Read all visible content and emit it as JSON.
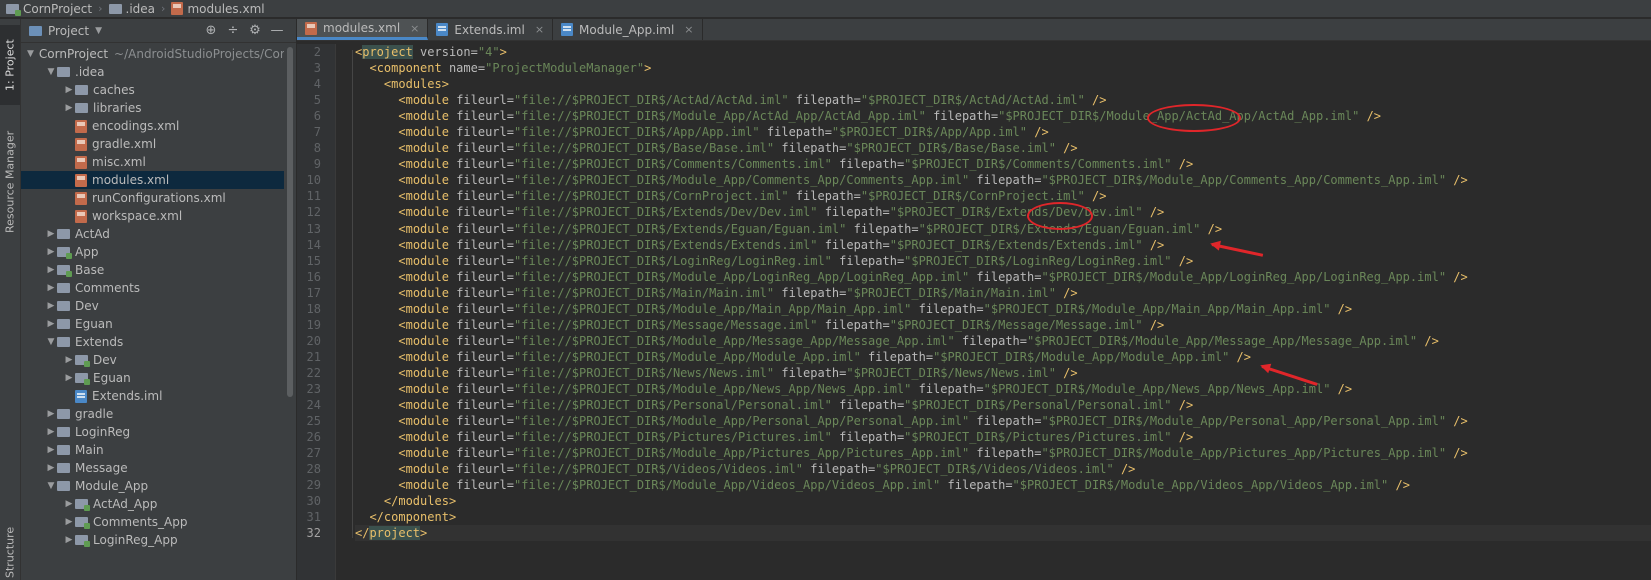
{
  "breadcrumb": [
    "CornProject",
    ".idea",
    "modules.xml"
  ],
  "left_strip": {
    "project_tab": "1: Project",
    "resource_tab": "Resource Manager",
    "structure_tab": "Structure"
  },
  "project_panel": {
    "title": "Project",
    "tree": [
      {
        "label": "CornProject",
        "hint": "~/AndroidStudioProjects/Cor",
        "indent": 0,
        "expanded": true,
        "icon": "folder-icon"
      },
      {
        "label": ".idea",
        "indent": 1,
        "expanded": true,
        "icon": "folder-icon"
      },
      {
        "label": "caches",
        "indent": 2,
        "expanded": false,
        "icon": "folder-icon"
      },
      {
        "label": "libraries",
        "indent": 2,
        "expanded": false,
        "icon": "folder-icon"
      },
      {
        "label": "encodings.xml",
        "indent": 2,
        "icon": "xml-file-icon"
      },
      {
        "label": "gradle.xml",
        "indent": 2,
        "icon": "xml-file-icon"
      },
      {
        "label": "misc.xml",
        "indent": 2,
        "icon": "xml-file-icon"
      },
      {
        "label": "modules.xml",
        "indent": 2,
        "icon": "xml-file-icon",
        "selected": true
      },
      {
        "label": "runConfigurations.xml",
        "indent": 2,
        "icon": "xml-file-icon"
      },
      {
        "label": "workspace.xml",
        "indent": 2,
        "icon": "xml-file-icon"
      },
      {
        "label": "ActAd",
        "indent": 1,
        "expanded": false,
        "icon": "folder-icon"
      },
      {
        "label": "App",
        "indent": 1,
        "expanded": false,
        "icon": "module-folder-icon"
      },
      {
        "label": "Base",
        "indent": 1,
        "expanded": false,
        "icon": "module-folder-icon"
      },
      {
        "label": "Comments",
        "indent": 1,
        "expanded": false,
        "icon": "folder-icon"
      },
      {
        "label": "Dev",
        "indent": 1,
        "expanded": false,
        "icon": "folder-icon"
      },
      {
        "label": "Eguan",
        "indent": 1,
        "expanded": false,
        "icon": "folder-icon"
      },
      {
        "label": "Extends",
        "indent": 1,
        "expanded": true,
        "icon": "folder-icon"
      },
      {
        "label": "Dev",
        "indent": 2,
        "expanded": false,
        "icon": "module-folder-icon"
      },
      {
        "label": "Eguan",
        "indent": 2,
        "expanded": false,
        "icon": "module-folder-icon"
      },
      {
        "label": "Extends.iml",
        "indent": 2,
        "icon": "iml-file-icon"
      },
      {
        "label": "gradle",
        "indent": 1,
        "expanded": false,
        "icon": "folder-icon"
      },
      {
        "label": "LoginReg",
        "indent": 1,
        "expanded": false,
        "icon": "folder-icon"
      },
      {
        "label": "Main",
        "indent": 1,
        "expanded": false,
        "icon": "folder-icon"
      },
      {
        "label": "Message",
        "indent": 1,
        "expanded": false,
        "icon": "folder-icon"
      },
      {
        "label": "Module_App",
        "indent": 1,
        "expanded": true,
        "icon": "folder-icon"
      },
      {
        "label": "ActAd_App",
        "indent": 2,
        "expanded": false,
        "icon": "module-folder-icon"
      },
      {
        "label": "Comments_App",
        "indent": 2,
        "expanded": false,
        "icon": "module-folder-icon"
      },
      {
        "label": "LoginReg_App",
        "indent": 2,
        "expanded": false,
        "icon": "module-folder-icon"
      }
    ]
  },
  "tabs": [
    {
      "label": "modules.xml",
      "icon": "xml-file-icon",
      "active": true
    },
    {
      "label": "Extends.iml",
      "icon": "iml-file-icon",
      "active": false
    },
    {
      "label": "Module_App.iml",
      "icon": "iml-file-icon",
      "active": false
    }
  ],
  "editor": {
    "current_line": 32,
    "lines": [
      {
        "n": 2,
        "indent": 0,
        "tag": "project",
        "kind": "open",
        "attrs": [
          [
            "version",
            "4"
          ]
        ]
      },
      {
        "n": 3,
        "indent": 1,
        "tag": "component",
        "kind": "open",
        "attrs": [
          [
            "name",
            "ProjectModuleManager"
          ]
        ]
      },
      {
        "n": 4,
        "indent": 2,
        "tag": "modules",
        "kind": "open",
        "attrs": []
      },
      {
        "n": 5,
        "indent": 3,
        "tag": "module",
        "kind": "self",
        "attrs": [
          [
            "fileurl",
            "file://$PROJECT_DIR$/ActAd/ActAd.iml"
          ],
          [
            "filepath",
            "$PROJECT_DIR$/ActAd/ActAd.iml"
          ]
        ]
      },
      {
        "n": 6,
        "indent": 3,
        "tag": "module",
        "kind": "self",
        "attrs": [
          [
            "fileurl",
            "file://$PROJECT_DIR$/Module_App/ActAd_App/ActAd_App.iml"
          ],
          [
            "filepath",
            "$PROJECT_DIR$/Module_App/ActAd_App/ActAd_App.iml"
          ]
        ]
      },
      {
        "n": 7,
        "indent": 3,
        "tag": "module",
        "kind": "self",
        "attrs": [
          [
            "fileurl",
            "file://$PROJECT_DIR$/App/App.iml"
          ],
          [
            "filepath",
            "$PROJECT_DIR$/App/App.iml"
          ]
        ]
      },
      {
        "n": 8,
        "indent": 3,
        "tag": "module",
        "kind": "self",
        "attrs": [
          [
            "fileurl",
            "file://$PROJECT_DIR$/Base/Base.iml"
          ],
          [
            "filepath",
            "$PROJECT_DIR$/Base/Base.iml"
          ]
        ]
      },
      {
        "n": 9,
        "indent": 3,
        "tag": "module",
        "kind": "self",
        "attrs": [
          [
            "fileurl",
            "file://$PROJECT_DIR$/Comments/Comments.iml"
          ],
          [
            "filepath",
            "$PROJECT_DIR$/Comments/Comments.iml"
          ]
        ]
      },
      {
        "n": 10,
        "indent": 3,
        "tag": "module",
        "kind": "self",
        "attrs": [
          [
            "fileurl",
            "file://$PROJECT_DIR$/Module_App/Comments_App/Comments_App.iml"
          ],
          [
            "filepath",
            "$PROJECT_DIR$/Module_App/Comments_App/Comments_App.iml"
          ]
        ]
      },
      {
        "n": 11,
        "indent": 3,
        "tag": "module",
        "kind": "self",
        "attrs": [
          [
            "fileurl",
            "file://$PROJECT_DIR$/CornProject.iml"
          ],
          [
            "filepath",
            "$PROJECT_DIR$/CornProject.iml"
          ]
        ]
      },
      {
        "n": 12,
        "indent": 3,
        "tag": "module",
        "kind": "self",
        "attrs": [
          [
            "fileurl",
            "file://$PROJECT_DIR$/Extends/Dev/Dev.iml"
          ],
          [
            "filepath",
            "$PROJECT_DIR$/Extends/Dev/Dev.iml"
          ]
        ]
      },
      {
        "n": 13,
        "indent": 3,
        "tag": "module",
        "kind": "self",
        "attrs": [
          [
            "fileurl",
            "file://$PROJECT_DIR$/Extends/Eguan/Eguan.iml"
          ],
          [
            "filepath",
            "$PROJECT_DIR$/Extends/Eguan/Eguan.iml"
          ]
        ]
      },
      {
        "n": 14,
        "indent": 3,
        "tag": "module",
        "kind": "self",
        "attrs": [
          [
            "fileurl",
            "file://$PROJECT_DIR$/Extends/Extends.iml"
          ],
          [
            "filepath",
            "$PROJECT_DIR$/Extends/Extends.iml"
          ]
        ]
      },
      {
        "n": 15,
        "indent": 3,
        "tag": "module",
        "kind": "self",
        "attrs": [
          [
            "fileurl",
            "file://$PROJECT_DIR$/LoginReg/LoginReg.iml"
          ],
          [
            "filepath",
            "$PROJECT_DIR$/LoginReg/LoginReg.iml"
          ]
        ]
      },
      {
        "n": 16,
        "indent": 3,
        "tag": "module",
        "kind": "self",
        "attrs": [
          [
            "fileurl",
            "file://$PROJECT_DIR$/Module_App/LoginReg_App/LoginReg_App.iml"
          ],
          [
            "filepath",
            "$PROJECT_DIR$/Module_App/LoginReg_App/LoginReg_App.iml"
          ]
        ]
      },
      {
        "n": 17,
        "indent": 3,
        "tag": "module",
        "kind": "self",
        "attrs": [
          [
            "fileurl",
            "file://$PROJECT_DIR$/Main/Main.iml"
          ],
          [
            "filepath",
            "$PROJECT_DIR$/Main/Main.iml"
          ]
        ]
      },
      {
        "n": 18,
        "indent": 3,
        "tag": "module",
        "kind": "self",
        "attrs": [
          [
            "fileurl",
            "file://$PROJECT_DIR$/Module_App/Main_App/Main_App.iml"
          ],
          [
            "filepath",
            "$PROJECT_DIR$/Module_App/Main_App/Main_App.iml"
          ]
        ]
      },
      {
        "n": 19,
        "indent": 3,
        "tag": "module",
        "kind": "self",
        "attrs": [
          [
            "fileurl",
            "file://$PROJECT_DIR$/Message/Message.iml"
          ],
          [
            "filepath",
            "$PROJECT_DIR$/Message/Message.iml"
          ]
        ]
      },
      {
        "n": 20,
        "indent": 3,
        "tag": "module",
        "kind": "self",
        "attrs": [
          [
            "fileurl",
            "file://$PROJECT_DIR$/Module_App/Message_App/Message_App.iml"
          ],
          [
            "filepath",
            "$PROJECT_DIR$/Module_App/Message_App/Message_App.iml"
          ]
        ]
      },
      {
        "n": 21,
        "indent": 3,
        "tag": "module",
        "kind": "self",
        "attrs": [
          [
            "fileurl",
            "file://$PROJECT_DIR$/Module_App/Module_App.iml"
          ],
          [
            "filepath",
            "$PROJECT_DIR$/Module_App/Module_App.iml"
          ]
        ]
      },
      {
        "n": 22,
        "indent": 3,
        "tag": "module",
        "kind": "self",
        "attrs": [
          [
            "fileurl",
            "file://$PROJECT_DIR$/News/News.iml"
          ],
          [
            "filepath",
            "$PROJECT_DIR$/News/News.iml"
          ]
        ]
      },
      {
        "n": 23,
        "indent": 3,
        "tag": "module",
        "kind": "self",
        "attrs": [
          [
            "fileurl",
            "file://$PROJECT_DIR$/Module_App/News_App/News_App.iml"
          ],
          [
            "filepath",
            "$PROJECT_DIR$/Module_App/News_App/News_App.iml"
          ]
        ]
      },
      {
        "n": 24,
        "indent": 3,
        "tag": "module",
        "kind": "self",
        "attrs": [
          [
            "fileurl",
            "file://$PROJECT_DIR$/Personal/Personal.iml"
          ],
          [
            "filepath",
            "$PROJECT_DIR$/Personal/Personal.iml"
          ]
        ]
      },
      {
        "n": 25,
        "indent": 3,
        "tag": "module",
        "kind": "self",
        "attrs": [
          [
            "fileurl",
            "file://$PROJECT_DIR$/Module_App/Personal_App/Personal_App.iml"
          ],
          [
            "filepath",
            "$PROJECT_DIR$/Module_App/Personal_App/Personal_App.iml"
          ]
        ]
      },
      {
        "n": 26,
        "indent": 3,
        "tag": "module",
        "kind": "self",
        "attrs": [
          [
            "fileurl",
            "file://$PROJECT_DIR$/Pictures/Pictures.iml"
          ],
          [
            "filepath",
            "$PROJECT_DIR$/Pictures/Pictures.iml"
          ]
        ]
      },
      {
        "n": 27,
        "indent": 3,
        "tag": "module",
        "kind": "self",
        "attrs": [
          [
            "fileurl",
            "file://$PROJECT_DIR$/Module_App/Pictures_App/Pictures_App.iml"
          ],
          [
            "filepath",
            "$PROJECT_DIR$/Module_App/Pictures_App/Pictures_App.iml"
          ]
        ]
      },
      {
        "n": 28,
        "indent": 3,
        "tag": "module",
        "kind": "self",
        "attrs": [
          [
            "fileurl",
            "file://$PROJECT_DIR$/Videos/Videos.iml"
          ],
          [
            "filepath",
            "$PROJECT_DIR$/Videos/Videos.iml"
          ]
        ]
      },
      {
        "n": 29,
        "indent": 3,
        "tag": "module",
        "kind": "self",
        "attrs": [
          [
            "fileurl",
            "file://$PROJECT_DIR$/Module_App/Videos_App/Videos_App.iml"
          ],
          [
            "filepath",
            "$PROJECT_DIR$/Module_App/Videos_App/Videos_App.iml"
          ]
        ]
      },
      {
        "n": 30,
        "indent": 2,
        "tag": "modules",
        "kind": "close",
        "attrs": []
      },
      {
        "n": 31,
        "indent": 1,
        "tag": "component",
        "kind": "close",
        "attrs": []
      },
      {
        "n": 32,
        "indent": 0,
        "tag": "project",
        "kind": "close",
        "attrs": []
      }
    ]
  },
  "colors": {
    "editor_bg": "#2b2b2b",
    "panel_bg": "#3c3f41",
    "tag": "#e8bf6a",
    "attribute": "#bababa",
    "value": "#6a8759",
    "annotation_red": "#e0262a",
    "selection": "#0d293e"
  }
}
